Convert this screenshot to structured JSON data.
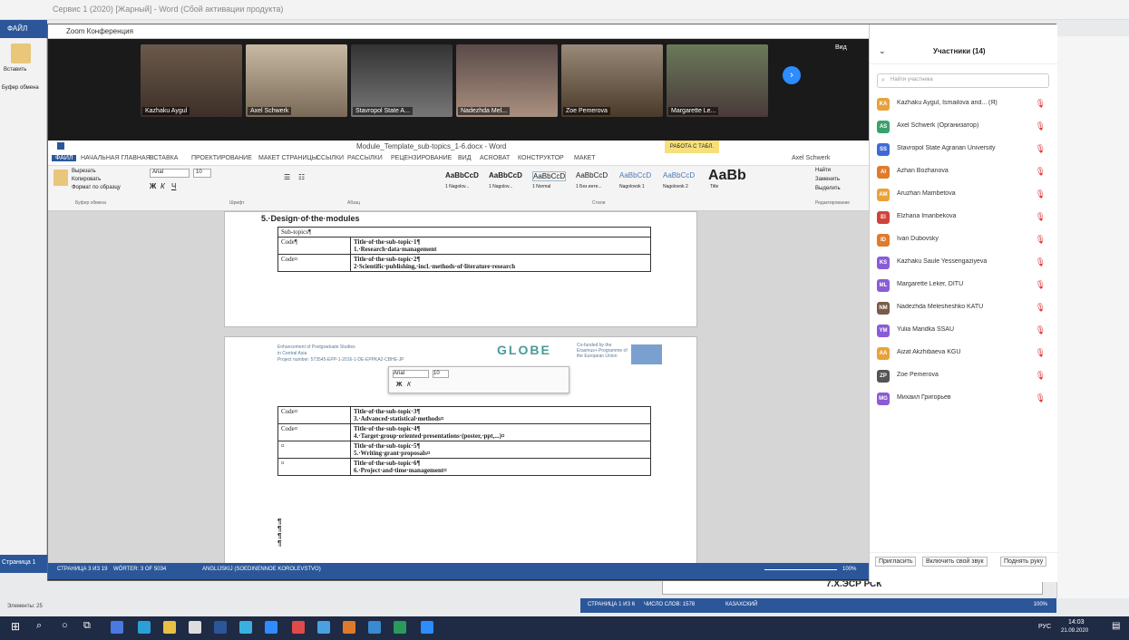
{
  "bg_window": {
    "title": "Сервис 1 (2020) [Жарный] - Word (Сбой активации продукта)",
    "left_tab": "ФАЙЛ",
    "left_items": [
      "Вставить",
      "Буфер обмена"
    ],
    "status_left": "Страница 1",
    "bottom_status": [
      "СТРАНИЦА 1 ИЗ 6",
      "ЧИСЛО СЛОВ: 1578",
      "КАЗАХСКИЙ"
    ],
    "bottom_caption": "Элементы: 25",
    "zoom": "100%",
    "text_fragment": "7.Х.ЭСР РСК"
  },
  "zoom": {
    "title": "Zoom Конференция",
    "videos": [
      {
        "name": "Kazhaku Aygul"
      },
      {
        "name": "Axel Schwerk"
      },
      {
        "name": "Stavropol State A..."
      },
      {
        "name": "Nadezhda Mel..."
      },
      {
        "name": "Zoe Pemerova"
      },
      {
        "name": "Margarette Le..."
      }
    ],
    "view_label": "Вид"
  },
  "word": {
    "title": "Module_Template_sub-topics_1-6.docx - Word",
    "user": "Axel Schwerk",
    "context_tab": "РАБОТА С ТАБЛ.",
    "tabs": [
      "ФАЙЛ",
      "НАЧАЛЬНАЯ ГЛАВНАЯ",
      "ВСТАВКА",
      "ПРОЕКТИРОВАНИЕ",
      "МАКЕТ СТРАНИЦЫ",
      "ССЫЛКИ",
      "РАССЫЛКИ",
      "РЕЦЕНЗИРОВАНИЕ",
      "ВИД",
      "ACROBAT",
      "КОНСТРУКТОР",
      "МАКЕТ"
    ],
    "font_name": "Arial",
    "font_size": "10",
    "styles": [
      "AaBbCcD",
      "AaBbCcD",
      "AaBbCcD",
      "AaBbCcD",
      "AaBbCcD",
      "AaBbCcD",
      "AaBb"
    ],
    "style_names": [
      "1 Nagolov...",
      "1 Nagolov...",
      "1 Normal",
      "1 Без инте...",
      "Nagolovok 1",
      "Nagolovok 2",
      "Title"
    ],
    "ribbon_groups": [
      "Буфер обмена",
      "Шрифт",
      "Абзац",
      "Стили",
      "Редактирование"
    ],
    "clipboard": [
      "Вырезать",
      "Копировать",
      "Формат по образцу"
    ],
    "edit": [
      "Найти",
      "Заменить",
      "Выделить"
    ],
    "heading": "5.·Design·of·the·modules",
    "table1": [
      [
        "Sub-topics¶",
        ""
      ],
      [
        "Code¶",
        "Title·of·the·sub-topic·1¶\n1.·Research·data·management"
      ],
      [
        "Code¤",
        "Title·of·the·sub-topic·2¶\n2·Scientific·publishing,·incl.·methods·of·literature·research"
      ]
    ],
    "header_lines": [
      "Enhancement of Postgraduate Studies",
      "in Central Asia",
      "Project number: 573545-EPP-1-2016-1-DE-EPPKA2-CBHE-JP"
    ],
    "logo": "GLOBE",
    "eu_caption": "Co-funded by the Erasmus+ Programme of the European Union",
    "table2": [
      [
        "Code¤",
        "Title·of·the·sub-topic·3¶\n3.·Advanced·statistical·methods¤"
      ],
      [
        "Code¤",
        "Title·of·the·sub-topic·4¶\n4.·Target·group·oriented·presentations·(poster,·ppt,...)¤"
      ],
      [
        "¤",
        "Title·of·the·sub-topic·5¶\n5.·Writing·grant·proposals¤"
      ],
      [
        "¤",
        "Title·of·the·sub-topic·6¶\n6.·Project·and·time·management¤"
      ]
    ],
    "para_marks": [
      "¶",
      "¶",
      "¶",
      "¶"
    ],
    "status": [
      "СТРАНИЦА 3 ИЗ 19",
      "WÖRTER: 3 OF 5034",
      "ANGLIJSKIJ (SOEDINENNOE KOROLEVSTVO)"
    ],
    "zoom": "100%"
  },
  "panel": {
    "title": "Участники (14)",
    "search_placeholder": "Найти участника",
    "participants": [
      {
        "initials": "KA",
        "name": "Kazhaku Aygul, Ismailova and... (Я)",
        "color": "#e8a23b"
      },
      {
        "initials": "AS",
        "name": "Axel Schwerk (Организатор)",
        "color": "#3aa16a"
      },
      {
        "initials": "SS",
        "name": "Stavropol State Agrarian University",
        "color": "#3d6ad6"
      },
      {
        "initials": "AI",
        "name": "Azhan Bozhanova",
        "color": "#e07b2d"
      },
      {
        "initials": "AM",
        "name": "Aruzhan Mambetova",
        "color": "#e8a23b"
      },
      {
        "initials": "EI",
        "name": "Elzhana Imanbekova",
        "color": "#d0433b"
      },
      {
        "initials": "ID",
        "name": "Ivan Dubovsky",
        "color": "#e07b2d"
      },
      {
        "initials": "KS",
        "name": "Kazhaku Saule Yessengaziyeva",
        "color": "#8a5cd6"
      },
      {
        "initials": "ML",
        "name": "Margarette Leker, DITU",
        "color": "#8a5cd6"
      },
      {
        "initials": "NM",
        "name": "Nadezhda Melesheshko KATU",
        "color": "#7a5a4a"
      },
      {
        "initials": "YM",
        "name": "Yulia Mandka SSAU",
        "color": "#8a5cd6"
      },
      {
        "initials": "AA",
        "name": "Aizat Akzhibaeva KGU",
        "color": "#e8a23b"
      },
      {
        "initials": "ZP",
        "name": "Zoe Pemerova",
        "color": "#555"
      },
      {
        "initials": "MG",
        "name": "Михаил Григорьев",
        "color": "#8a5cd6"
      }
    ],
    "buttons": [
      "Пригласить",
      "Включить свой звук",
      "Поднять руку"
    ]
  },
  "taskbar": {
    "time": "14:03",
    "date": "21.09.2020",
    "lang": "РУС"
  }
}
